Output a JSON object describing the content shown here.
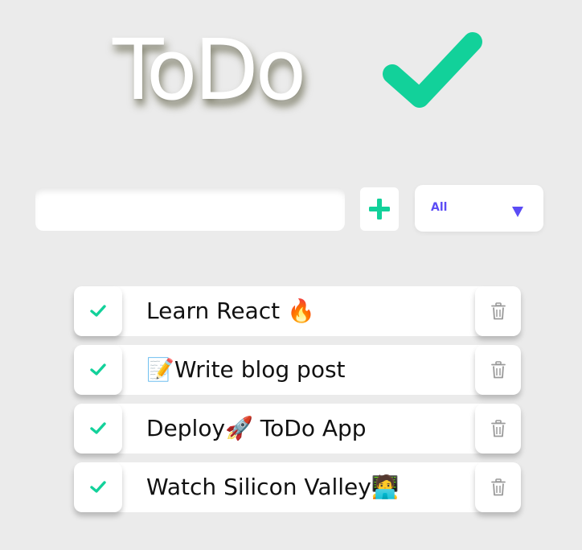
{
  "app": {
    "title": "ToDo",
    "accent_color": "#12d19a",
    "filter_color": "#5b4cf5"
  },
  "form": {
    "input_value": "",
    "add_icon": "plus-icon",
    "filter_selected": "All",
    "filter_icon": "triangle-down-icon"
  },
  "todos": [
    {
      "text": "Learn React 🔥",
      "complete_icon": "check-icon",
      "delete_icon": "trash-icon"
    },
    {
      "text": "📝Write blog post",
      "complete_icon": "check-icon",
      "delete_icon": "trash-icon"
    },
    {
      "text": "Deploy🚀 ToDo App",
      "complete_icon": "check-icon",
      "delete_icon": "trash-icon"
    },
    {
      "text": "Watch Silicon Valley🧑‍💻",
      "complete_icon": "check-icon",
      "delete_icon": "trash-icon"
    }
  ]
}
